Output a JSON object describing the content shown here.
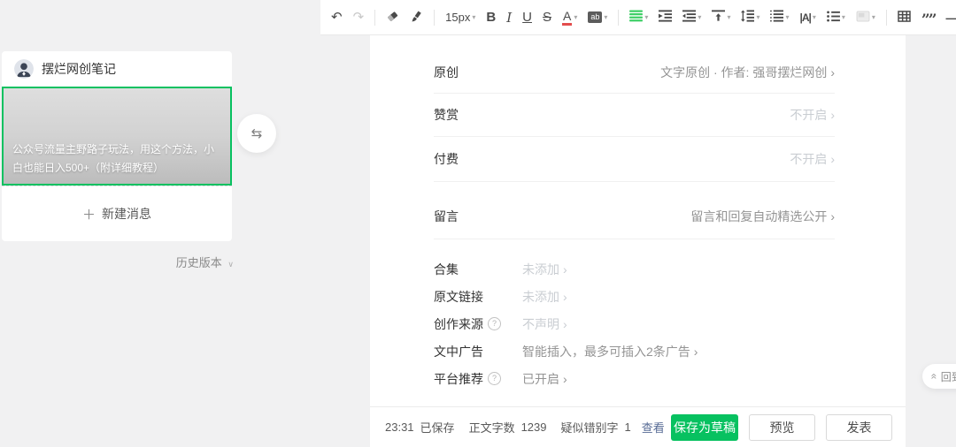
{
  "toolbar": {
    "font_size": "15px",
    "bold_label": "B",
    "italic_label": "I",
    "underline_label": "U",
    "strikethrough_label": "S",
    "font_color_label": "A",
    "highlight_label": "ab",
    "letter_spacing_label": "|A|",
    "code_label": "</>",
    "hr_label": "—",
    "quote_label": "””"
  },
  "icons": {
    "undo": "↶",
    "redo": "↷",
    "dropdown_caret": "▾",
    "swap": "⇆",
    "plus": "＋",
    "history_caret": "∨",
    "chevron_right": "›",
    "help": "?",
    "emoji": "☺",
    "up_chevrons": "«"
  },
  "sidebar": {
    "account_name": "摆烂网创笔记",
    "cover_title": "公众号流量主野路子玩法，用这个方法，小白也能日入500+（附详细教程）",
    "new_message_label": "新建消息",
    "history_label": "历史版本"
  },
  "settings": {
    "primary": [
      {
        "label": "原创",
        "value": "文字原创 · 作者: 强哥摆烂网创"
      },
      {
        "label": "赞赏",
        "value": "不开启"
      },
      {
        "label": "付费",
        "value": "不开启"
      },
      {
        "label": "留言",
        "value": "留言和回复自动精选公开"
      }
    ],
    "secondary": [
      {
        "label": "合集",
        "value": "未添加"
      },
      {
        "label": "原文链接",
        "value": "未添加"
      },
      {
        "label": "创作来源",
        "value": "不声明"
      },
      {
        "label": "文中广告",
        "value": "智能插入，最多可插入2条广告"
      },
      {
        "label": "平台推荐",
        "value": "已开启"
      }
    ]
  },
  "footer": {
    "save_time": "23:31",
    "saved_label": "已保存",
    "word_count_label": "正文字数",
    "word_count": "1239",
    "typo_label": "疑似错别字",
    "typo_count": "1",
    "check_link": "查看",
    "save_draft_label": "保存为草稿",
    "preview_label": "预览",
    "publish_label": "发表"
  },
  "floating": {
    "back_to_top_label": "回到顶部"
  },
  "colors": {
    "brand_green": "#07c160",
    "link_blue": "#576b95",
    "toolbar_green": "#3ecf66"
  }
}
